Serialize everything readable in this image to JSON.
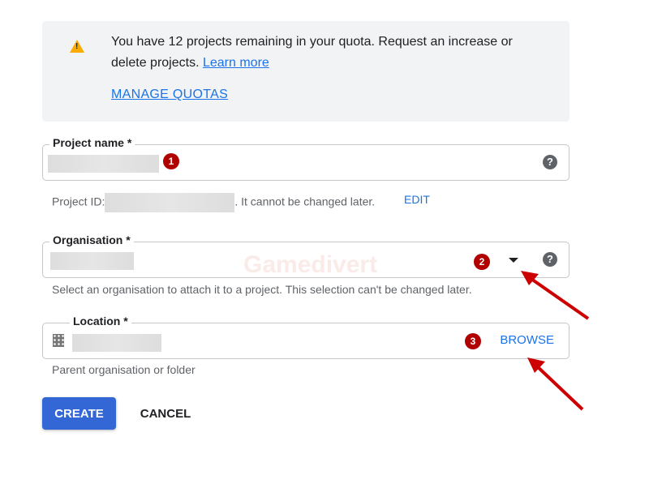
{
  "banner": {
    "icon": "warning-icon",
    "message": "You have 12 projects remaining in your quota. Request an increase or delete projects.",
    "learn_more": "Learn more",
    "manage_quotas": "MANAGE QUOTAS"
  },
  "project_name": {
    "label": "Project name *",
    "badge": "1",
    "help_icon": "help-icon"
  },
  "project_id": {
    "prefix": "Project ID:",
    "suffix": ". It cannot be changed later.",
    "edit": "EDIT"
  },
  "organisation": {
    "label": "Organisation *",
    "badge": "2",
    "hint": "Select an organisation to attach it to a project. This selection can't be changed later.",
    "dropdown_icon": "caret-down-icon"
  },
  "location": {
    "label": "Location *",
    "badge": "3",
    "browse": "BROWSE",
    "hint": "Parent organisation or folder",
    "icon": "building-icon"
  },
  "actions": {
    "create": "CREATE",
    "cancel": "CANCEL"
  },
  "watermark": "Gamedivert",
  "colors": {
    "accent": "#1a73e8",
    "button": "#3367d6",
    "badge": "#b00000",
    "warning": "#f9ab00"
  }
}
